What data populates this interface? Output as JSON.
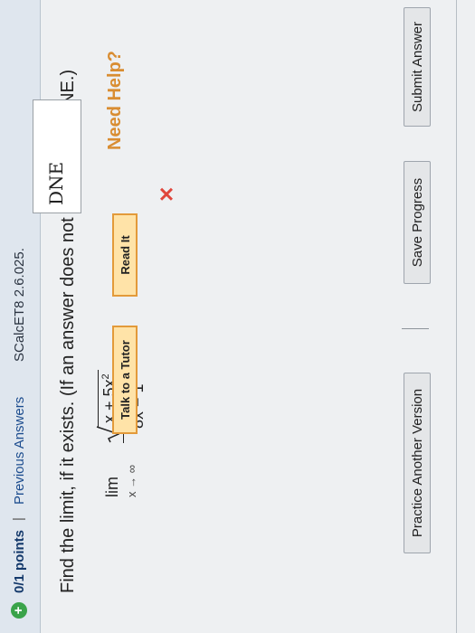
{
  "header": {
    "status_icon_glyph": "+",
    "points": "0/1 points",
    "separator": "|",
    "previous_answers": "Previous Answers",
    "source": "SCalcET8 2.6.025."
  },
  "question": {
    "prompt": "Find the limit, if it exists. (If an answer does not exist, enter DNE.)",
    "lim_word": "lim",
    "lim_subscript": "x → ∞",
    "numerator_radicand": "x + 5x",
    "numerator_exponent": "2",
    "denominator": "8x − 1"
  },
  "answer": {
    "value": "DNE",
    "status_icon_glyph": "✕"
  },
  "help": {
    "label": "Need Help?",
    "read_it": "Read It",
    "talk_to_tutor": "Talk to a Tutor"
  },
  "actions": {
    "submit": "Submit Answer",
    "save": "Save Progress",
    "separator": "|",
    "practice": "Practice Another Version"
  },
  "colors": {
    "correct_accent": "#3aa34a",
    "incorrect_accent": "#e0463c",
    "help_orange": "#d98d32",
    "link_blue": "#1d4d8f"
  }
}
